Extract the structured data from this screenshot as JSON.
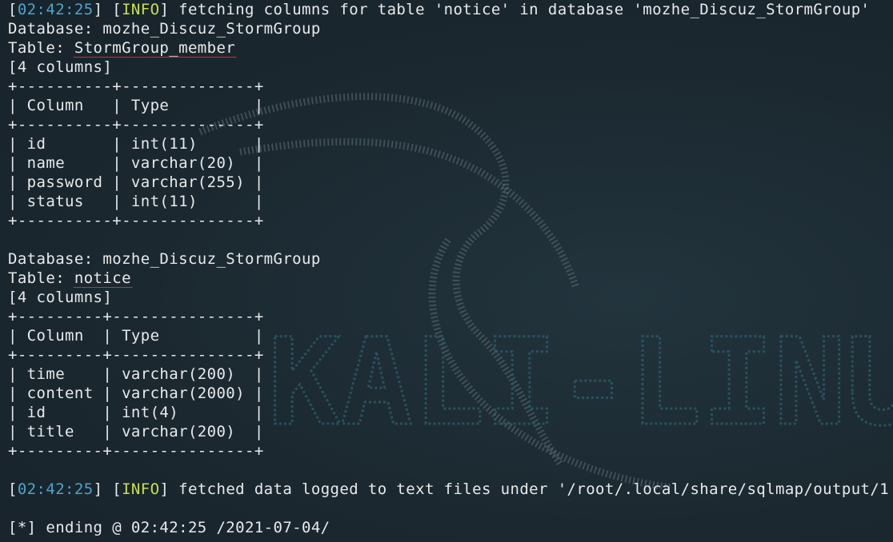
{
  "log": {
    "fetch_line": {
      "timestamp": "02:42:25",
      "level": "INFO",
      "message": " fetching columns for table 'notice' in database 'mozhe_Discuz_StormGroup'"
    },
    "fetched_line": {
      "timestamp": "02:42:25",
      "level": "INFO",
      "message": " fetched data logged to text files under '/root/.local/share/sqlmap/output/1"
    },
    "ending_line": "[*] ending @ 02:42:25 /2021-07-04/"
  },
  "block1": {
    "database_line": "Database: mozhe_Discuz_StormGroup",
    "table_prefix": "Table: ",
    "table_name": "StormGroup_member",
    "count_line": "[4 columns]",
    "border": "+----------+--------------+",
    "header": "| Column   | Type         |",
    "rows": [
      "| id       | int(11)      |",
      "| name     | varchar(20)  |",
      "| password | varchar(255) |",
      "| status   | int(11)      |"
    ]
  },
  "block2": {
    "database_line": "Database: mozhe_Discuz_StormGroup",
    "table_prefix": "Table: ",
    "table_name": "notice",
    "count_line": "[4 columns]",
    "border": "+---------+---------------+",
    "header": "| Column  | Type          |",
    "rows": [
      "| time    | varchar(200)  |",
      "| content | varchar(2000) |",
      "| id      | int(4)        |",
      "| title   | varchar(200)  |"
    ]
  },
  "wallpaper": {
    "logo_text": "KALI-LINUX"
  },
  "colors": {
    "background": "#1b2830",
    "text": "#e8eaeb",
    "timestamp": "#4ea3c8",
    "info": "#c8e04a",
    "underline": "#e0262b"
  }
}
